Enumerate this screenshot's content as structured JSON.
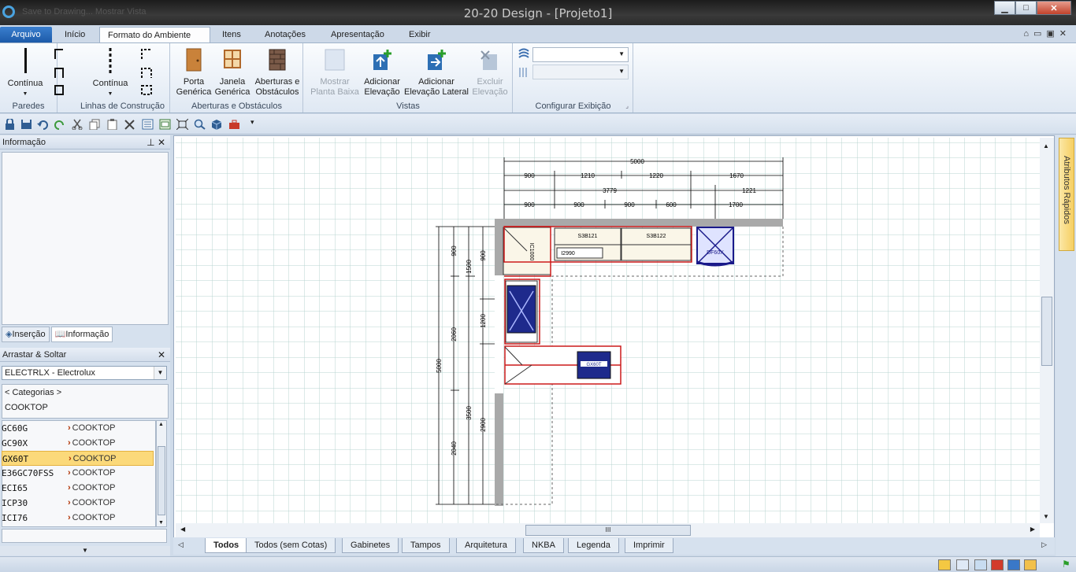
{
  "window": {
    "title": "20-20 Design - [Projeto1]",
    "ghost_tabs": "Save to Drawing...  Mostrar Vista"
  },
  "tabs": [
    {
      "label": "Arquivo"
    },
    {
      "label": "Início"
    },
    {
      "label": "Formato do Ambiente"
    },
    {
      "label": "Itens"
    },
    {
      "label": "Anotações"
    },
    {
      "label": "Apresentação"
    },
    {
      "label": "Exibir"
    }
  ],
  "ribbon": {
    "walls_continua": "Contínua",
    "group_walls": "Paredes",
    "construction_continua": "Contínua",
    "group_construction": "Linhas de Construção",
    "porta_l1": "Porta",
    "porta_l2": "Genérica",
    "janela_l1": "Janela",
    "janela_l2": "Genérica",
    "aberturas_l1": "Aberturas e",
    "aberturas_l2": "Obstáculos",
    "group_openings": "Aberturas e Obstáculos",
    "mostrar_l1": "Mostrar",
    "mostrar_l2": "Planta Baixa",
    "adicionar_l1": "Adicionar",
    "adicionar_l2": "Elevação",
    "adlat_l1": "Adicionar",
    "adlat_l2": "Elevação Lateral",
    "excluir_l1": "Excluir",
    "excluir_l2": "Elevação",
    "group_views": "Vistas",
    "group_display": "Configurar Exibição"
  },
  "left": {
    "info_title": "Informação",
    "tab_insercao": "Inserção",
    "tab_informacao": "Informação",
    "drag_title": "Arrastar & Soltar",
    "catalog": "ELECTRLX - Electrolux",
    "categories": "< Categorias >",
    "current_category": "COOKTOP",
    "items": [
      {
        "code": "GC60G",
        "cat": "COOKTOP"
      },
      {
        "code": "GC90X",
        "cat": "COOKTOP"
      },
      {
        "code": "GX60T",
        "cat": "COOKTOP"
      },
      {
        "code": "E36GC70FSS",
        "cat": "COOKTOP"
      },
      {
        "code": "ECI65",
        "cat": "COOKTOP"
      },
      {
        "code": "ICP30",
        "cat": "COOKTOP"
      },
      {
        "code": "ICI76",
        "cat": "COOKTOP"
      }
    ],
    "selected_index": 2
  },
  "rapid": "Atributos Rápidos",
  "drawing": {
    "top_dims": [
      "5000",
      "900",
      "1210",
      "1220",
      "1670",
      "3779",
      "1221",
      "900",
      "900",
      "900",
      "600",
      "1700"
    ],
    "left_dims": [
      "5000",
      "900",
      "1500",
      "900",
      "1200",
      "2060",
      "3500",
      "2900",
      "2040"
    ],
    "labels": [
      "S3B121",
      "S3B122",
      "I2990",
      "DF60X",
      "IC1000",
      "GX60T"
    ]
  },
  "bottom_tabs": [
    "Todos",
    "Todos (sem Cotas)",
    "Gabinetes",
    "Tampos",
    "Arquitetura",
    "NKBA",
    "Legenda",
    "Imprimir"
  ]
}
